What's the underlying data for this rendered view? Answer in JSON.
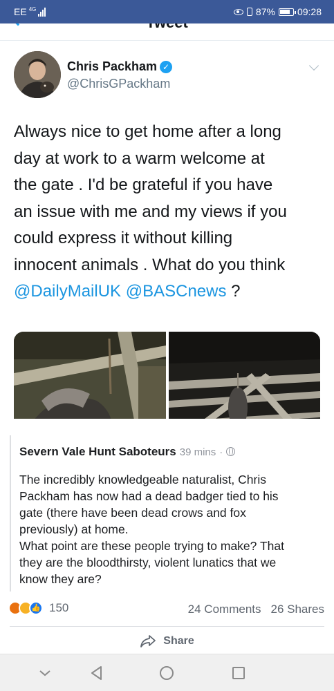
{
  "status_bar": {
    "carrier": "EE",
    "network": "4G",
    "battery": "87%",
    "time": "09:28"
  },
  "tweet": {
    "page_title": "Tweet",
    "author_name": "Chris Packham",
    "author_handle": "@ChrisGPackham",
    "text_lines": [
      "Always nice to get home after a long",
      "day at work to a warm welcome at",
      "the gate . I'd be grateful if you have",
      "an issue with me and my views if you",
      "could express it without killing",
      "innocent animals . What do you think"
    ],
    "mention_1": "@DailyMailUK",
    "mention_2": "@BASCnews",
    "text_end": " ?"
  },
  "post": {
    "page_name": "Severn Vale Hunt Saboteurs",
    "time": "39 mins",
    "separator": "·",
    "body_lines": [
      "The incredibly knowledgeable naturalist, Chris",
      "Packham has now had a dead badger tied to his",
      "gate (there have been dead crows and fox",
      "previously) at home.",
      "What point are these people trying to make? That",
      "they are the bloodthirsty, violent lunatics that we",
      "know they are?"
    ],
    "reactions_count": "150",
    "comments": "24 Comments",
    "shares": "26 Shares",
    "share_label": "Share"
  },
  "colors": {
    "status_bar": "#3b5998",
    "twitter_blue": "#1da1f2",
    "mention": "#1b95e0",
    "angry": "#e9710f",
    "sad": "#f7b125",
    "like": "#1877f2"
  }
}
